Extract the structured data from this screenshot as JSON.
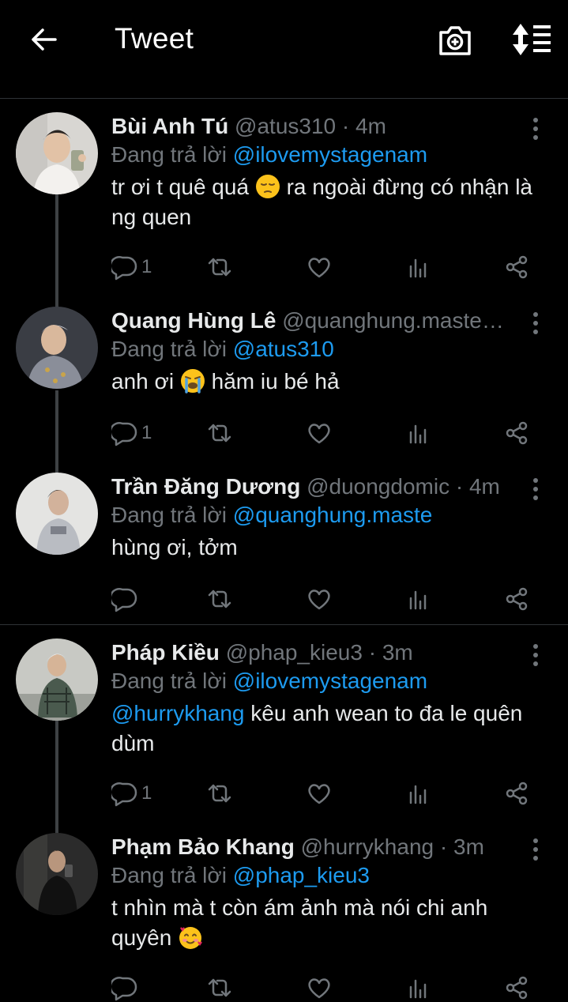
{
  "header": {
    "title": "Tweet"
  },
  "tweets": [
    {
      "name": "Bùi Anh Tú",
      "handle": "@atus310",
      "dot": "·",
      "time": "4m",
      "reply_prefix": "Đang trả lời",
      "reply_to": "@ilovemystagenam",
      "text_before": "tr ơi t quê quá",
      "emoji": "pensive-face-emoji",
      "text_after": "ra ngoài đừng có nhận là ng quen",
      "reply_count": "1"
    },
    {
      "name": "Quang Hùng Lê",
      "handle": "@quanghung.maste…",
      "reply_prefix": "Đang trả lời",
      "reply_to": "@atus310",
      "text_before": "anh ơi",
      "emoji": "crying-face-emoji",
      "text_after": "hăm iu bé hả",
      "reply_count": "1"
    },
    {
      "name": "Trần Đăng Dương",
      "handle": "@duongdomic",
      "dot": "·",
      "time": "4m",
      "reply_prefix": "Đang trả lời",
      "reply_to": "@quanghung.maste",
      "text": "hùng ơi, tởm"
    },
    {
      "name": "Pháp Kiều",
      "handle": "@phap_kieu3",
      "dot": "·",
      "time": "3m",
      "reply_prefix": "Đang trả lời",
      "reply_to": "@ilovemystagenam",
      "mention": "@hurrykhang",
      "text": "kêu anh wean to đa le quên dùm",
      "reply_count": "1"
    },
    {
      "name": "Phạm Bảo Khang",
      "handle": "@hurrykhang",
      "dot": "·",
      "time": "3m",
      "reply_prefix": "Đang trả lời",
      "reply_to": "@phap_kieu3",
      "text_before": "t nhìn mà t còn ám ảnh mà nói chi anh quyên",
      "emoji": "smiling-face-with-hearts-emoji"
    }
  ],
  "colors": {
    "background": "#000000",
    "link": "#1d9bf0",
    "muted": "#71767b",
    "text": "#e7e9ea"
  }
}
